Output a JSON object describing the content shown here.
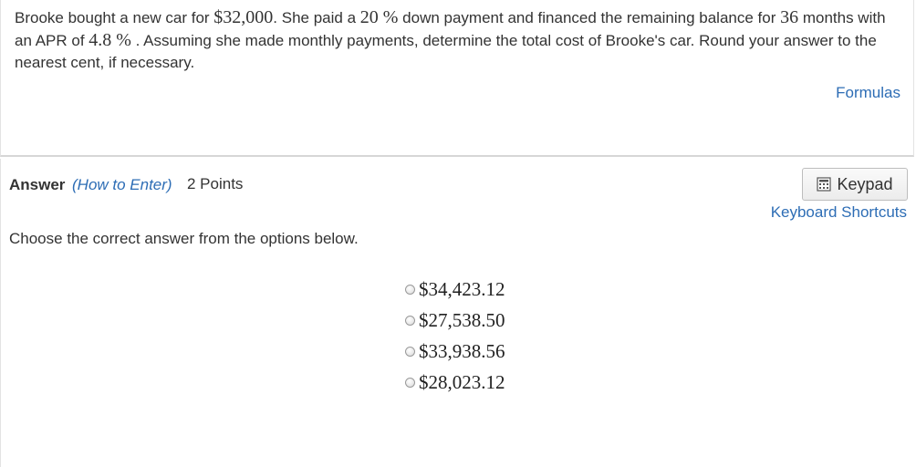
{
  "question": {
    "p1": "Brooke bought a new car for ",
    "price": "$32,000",
    "p2": ". She paid a ",
    "down_pct": "20 %",
    "p3": "  down payment and financed the remaining balance for ",
    "months": "36",
    "p4": " months with an APR of ",
    "apr": "4.8 %",
    "p5": " . Assuming she made monthly payments, determine the total cost of Brooke's car. Round your answer to the nearest cent, if necessary.",
    "formulas_link": "Formulas"
  },
  "answer": {
    "label": "Answer",
    "how_to_enter": "(How to Enter)",
    "points": "2 Points",
    "keypad_button": "Keypad",
    "keyboard_shortcuts": "Keyboard Shortcuts",
    "instructions": "Choose the correct answer from the options below.",
    "options": [
      "$34,423.12",
      "$27,538.50",
      "$33,938.56",
      "$28,023.12"
    ]
  },
  "icons": {
    "keypad": "keypad-icon",
    "radio": "radio-button"
  },
  "colors": {
    "link": "#2d6db5",
    "text": "#333333",
    "divider": "#d6d6d6"
  }
}
